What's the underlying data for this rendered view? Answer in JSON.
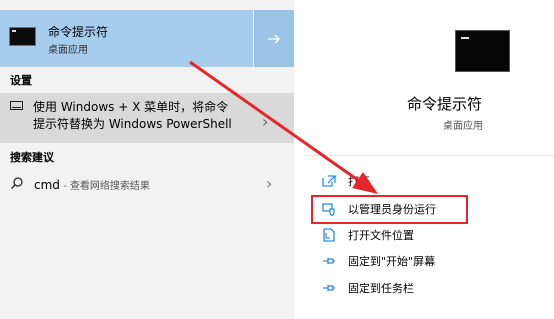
{
  "left": {
    "best_match": {
      "title": "命令提示符",
      "subtitle": "桌面应用"
    },
    "settings_header": "设置",
    "setting_item": {
      "line1": "使用 Windows + X 菜单时，将命令",
      "line2": "提示符替换为 Windows PowerShell"
    },
    "search_header": "搜索建议",
    "search_item": {
      "query": "cmd",
      "suffix": " - 查看网络搜索结果"
    }
  },
  "right": {
    "app_name": "命令提示符",
    "app_type": "桌面应用",
    "actions": [
      {
        "label": "打开",
        "icon": "open-icon"
      },
      {
        "label": "以管理员身份运行",
        "icon": "shield-admin-icon"
      },
      {
        "label": "打开文件位置",
        "icon": "file-location-icon"
      },
      {
        "label": "固定到\"开始\"屏幕",
        "icon": "pin-icon"
      },
      {
        "label": "固定到任务栏",
        "icon": "pin-icon"
      }
    ]
  },
  "colors": {
    "selected_bg": "#a7cdee",
    "accent_blue": "#0078d7",
    "annotation_red": "#e5262b"
  }
}
